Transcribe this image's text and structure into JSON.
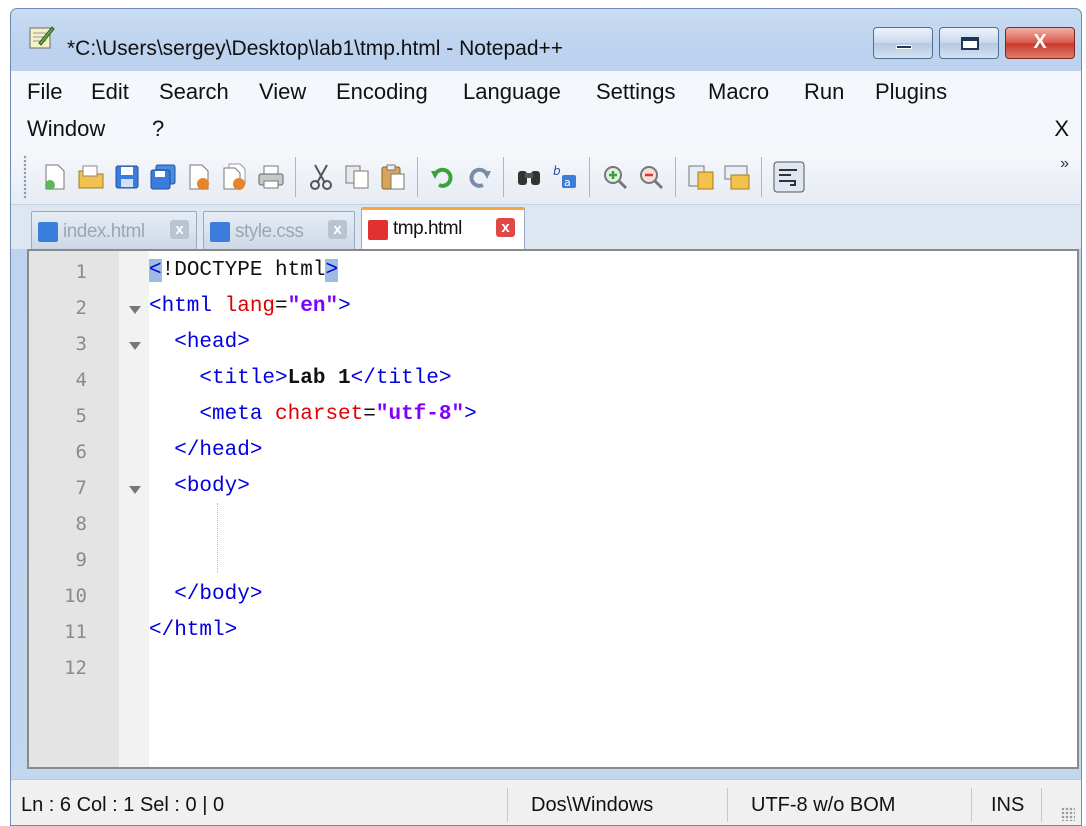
{
  "window": {
    "title": "*C:\\Users\\sergey\\Desktop\\lab1\\tmp.html - Notepad++",
    "minimize_label": "",
    "maximize_label": "",
    "close_label": "X"
  },
  "menu": {
    "items": [
      "File",
      "Edit",
      "Search",
      "View",
      "Encoding",
      "Language",
      "Settings",
      "Macro",
      "Run",
      "Plugins",
      "Window",
      "?"
    ],
    "close_doc": "X"
  },
  "toolbar": {
    "icons": [
      "new-file-icon",
      "open-file-icon",
      "save-icon",
      "save-all-icon",
      "close-icon",
      "close-all-icon",
      "print-icon",
      "cut-icon",
      "copy-icon",
      "paste-icon",
      "undo-icon",
      "redo-icon",
      "find-icon",
      "replace-icon",
      "zoom-in-icon",
      "zoom-out-icon",
      "sync-vertical-icon",
      "sync-horizontal-icon",
      "word-wrap-icon"
    ],
    "more": "»"
  },
  "tabs": [
    {
      "label": "index.html",
      "close": "x",
      "icon": "saved-file-icon",
      "color": "#3b7ddd"
    },
    {
      "label": "style.css",
      "close": "x",
      "icon": "saved-file-icon",
      "color": "#3b7ddd"
    },
    {
      "label": "tmp.html",
      "close": "x",
      "icon": "modified-file-icon",
      "color": "#e03030"
    }
  ],
  "editor": {
    "line_numbers": [
      "1",
      "2",
      "3",
      "4",
      "5",
      "6",
      "7",
      "8",
      "9",
      "10",
      "11",
      "12"
    ],
    "lines": {
      "l1": {
        "open": "<",
        "doctype": "!DOCTYPE html",
        "close": ">"
      },
      "l2": {
        "tag_open": "<html",
        "attr": "lang",
        "eq": "=",
        "val": "\"en\"",
        "tag_close": ">"
      },
      "l3": {
        "tag": "<head>"
      },
      "l4": {
        "open": "<title>",
        "text": "Lab 1",
        "close": "</title>"
      },
      "l5": {
        "tag_open": "<meta",
        "attr": "charset",
        "eq": "=",
        "val": "\"utf-8\"",
        "tag_close": ">"
      },
      "l6": {
        "tag": "</head>"
      },
      "l7": {
        "tag": "<body>"
      },
      "l10": {
        "tag": "</body>"
      },
      "l11": {
        "tag": "</html>"
      }
    }
  },
  "status": {
    "position": "Ln : 6    Col : 1    Sel : 0 | 0",
    "eol": "Dos\\Windows",
    "encoding": "UTF-8 w/o BOM",
    "mode": "INS"
  },
  "colors": {
    "tag": "#0000e0",
    "attribute": "#e00000",
    "value": "#8000ff",
    "active_tab_accent": "#f7a541"
  }
}
